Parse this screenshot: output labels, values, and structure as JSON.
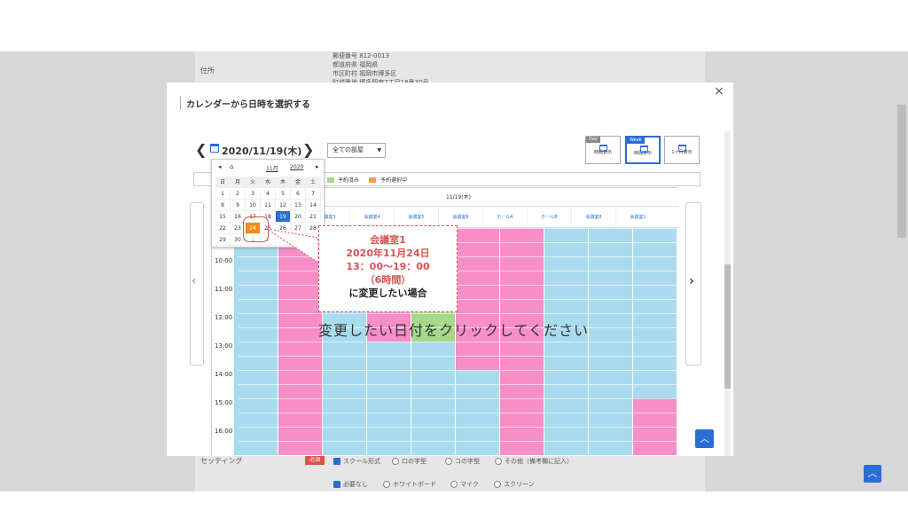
{
  "background": {
    "address_label": "住所",
    "address_lines": [
      "郵便番号 812-0013",
      "都道府県 福岡県",
      "市区町村 福岡市博多区",
      "町域番地 博多駅東2丁目18番30号"
    ],
    "seating_label": "セッティング",
    "required_badge": "必須",
    "seating_options": [
      "スクール形式",
      "口の字型",
      "コの字型",
      "その他（備考欄に記入）"
    ],
    "equipment_options": [
      "必要なし",
      "ホワイトボード",
      "マイク",
      "スクリーン"
    ]
  },
  "modal": {
    "title": "カレンダーから日時を選択する",
    "close": "×",
    "date": "2020/11/19(木)",
    "room_select": "全ての部屋",
    "views": [
      {
        "tag": "Day",
        "label": "時間表示"
      },
      {
        "tag": "Week",
        "label": "時間表示"
      },
      {
        "tag": "",
        "label": "1ヶ月表示"
      }
    ],
    "legend": [
      {
        "label": "予約済み",
        "color": "#a6d78a"
      },
      {
        "label": "予約選択中",
        "color": "#f0a04b"
      }
    ],
    "day_header": "11/19(木)",
    "rooms": [
      "会議室3",
      "会議室4",
      "会議室5",
      "会議室6",
      "ホールA",
      "ホールB",
      "会議室8",
      "会議室1"
    ],
    "times": [
      "10:00",
      "11:00",
      "12:00",
      "13:00",
      "14:00",
      "15:00",
      "16:00"
    ],
    "colors": {
      "available": "#a9dbee",
      "booked_pink": "#f78ec7",
      "booked_green": "#a6d78a",
      "accent": "#2a6dd6"
    }
  },
  "mini_calendar": {
    "month": "11月",
    "year": "2020",
    "dow": [
      "日",
      "月",
      "火",
      "水",
      "木",
      "金",
      "土"
    ],
    "weeks": [
      [
        "1",
        "2",
        "3",
        "4",
        "5",
        "6",
        "7"
      ],
      [
        "8",
        "9",
        "10",
        "11",
        "12",
        "13",
        "14"
      ],
      [
        "15",
        "16",
        "17",
        "18",
        "19",
        "20",
        "21"
      ],
      [
        "22",
        "23",
        "24",
        "25",
        "26",
        "27",
        "28"
      ],
      [
        "29",
        "30",
        "1",
        "2",
        "3",
        "4",
        "5"
      ]
    ],
    "today": "19",
    "selected": "24"
  },
  "callout": {
    "line1": "会議室1",
    "line2": "2020年11月24日",
    "line3": "13：00〜19：00",
    "line4": "（6時間）",
    "line5": "に変更したい場合"
  },
  "hint": "変更したい日付をクリックしてください"
}
